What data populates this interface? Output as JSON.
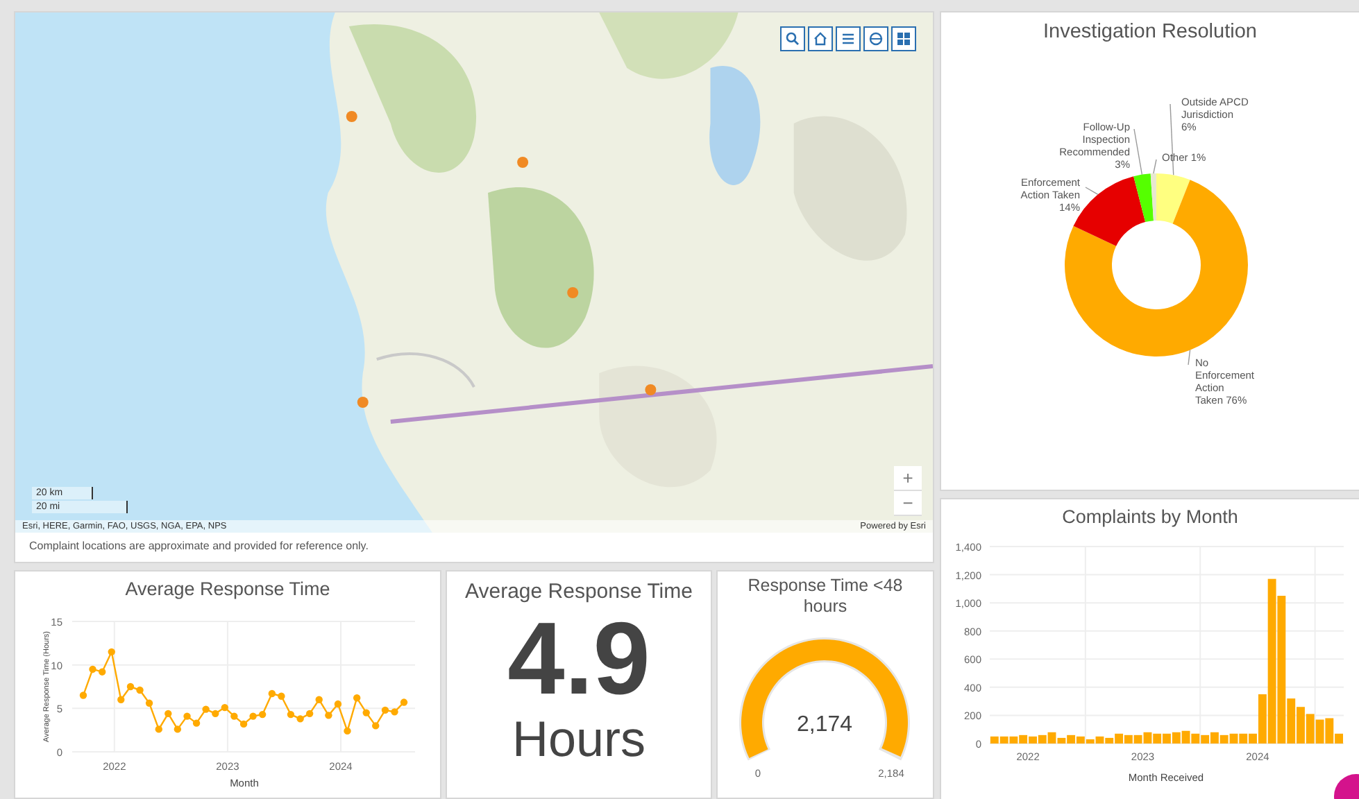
{
  "map": {
    "attribution": "Esri, HERE, Garmin, FAO, USGS, NGA, EPA, NPS",
    "powered_by": "Powered by Esri",
    "footer": "Complaint locations are approximate and provided for reference only.",
    "scale": [
      "20 km",
      "20 mi"
    ],
    "zoom_in": "+",
    "zoom_out": "−",
    "picture": {
      "kind": "picture"
    }
  },
  "investigation": {
    "title": "Investigation Resolution",
    "chart_data": {
      "type": "donut",
      "categories": [
        "Outside APCD Jurisdiction",
        "No Enforcement Action Taken",
        "Enforcement Action Taken",
        "Follow-Up Inspection Recommended",
        "Other"
      ],
      "values": [
        6,
        76,
        14,
        3,
        1
      ],
      "colors": [
        "#ffff80",
        "#ffaa00",
        "#e60000",
        "#55ff00",
        "#e8e8d0"
      ],
      "value_labels": [
        "6%",
        "76%",
        "14%",
        "3%",
        "1%"
      ]
    }
  },
  "complaints": {
    "title": "Complaints by Month",
    "chart_data": {
      "type": "bar",
      "xlabel": "Month Received",
      "x": [
        2021.708,
        2021.792,
        2021.875,
        2021.958,
        2022.042,
        2022.125,
        2022.208,
        2022.292,
        2022.375,
        2022.458,
        2022.542,
        2022.625,
        2022.708,
        2022.792,
        2022.875,
        2022.958,
        2023.042,
        2023.125,
        2023.208,
        2023.292,
        2023.375,
        2023.458,
        2023.542,
        2023.625,
        2023.708,
        2023.792,
        2023.875,
        2023.958,
        2024.042,
        2024.125,
        2024.208,
        2024.292,
        2024.375,
        2024.458,
        2024.542,
        2024.625,
        2024.708
      ],
      "xlim": [
        2021.667,
        2024.75
      ],
      "ylim": [
        0,
        1400
      ],
      "grid": true,
      "series": [
        {
          "color": "#ffaa00",
          "values": [
            50,
            50,
            50,
            60,
            50,
            60,
            80,
            40,
            60,
            50,
            30,
            50,
            40,
            70,
            60,
            60,
            80,
            70,
            70,
            80,
            90,
            70,
            60,
            80,
            60,
            70,
            70,
            70,
            350,
            1170,
            1050,
            320,
            260,
            210,
            170,
            180,
            70
          ]
        }
      ],
      "xticks": [
        {
          "value": 2022,
          "label": "2022"
        },
        {
          "value": 2023,
          "label": "2023"
        },
        {
          "value": 2024,
          "label": "2024"
        }
      ],
      "yticks": [
        {
          "value": 0,
          "label": "0"
        },
        {
          "value": 200,
          "label": "200"
        },
        {
          "value": 400,
          "label": "400"
        },
        {
          "value": 600,
          "label": "600"
        },
        {
          "value": 800,
          "label": "800"
        },
        {
          "value": 1000,
          "label": "1,000"
        },
        {
          "value": 1200,
          "label": "1,200"
        },
        {
          "value": 1400,
          "label": "1,400"
        }
      ]
    }
  },
  "response_chart": {
    "title": "Average Response Time",
    "chart_data": {
      "type": "line",
      "xlabel": "Month",
      "ylabel": "Average Response Time (Hours)",
      "x": [
        2021.725,
        2021.808,
        2021.892,
        2021.975,
        2022.058,
        2022.142,
        2022.225,
        2022.308,
        2022.392,
        2022.475,
        2022.558,
        2022.642,
        2022.725,
        2022.808,
        2022.892,
        2022.975,
        2023.058,
        2023.142,
        2023.225,
        2023.308,
        2023.392,
        2023.475,
        2023.558,
        2023.642,
        2023.725,
        2023.808,
        2023.892,
        2023.975,
        2024.058,
        2024.142,
        2024.225,
        2024.308,
        2024.392,
        2024.475,
        2024.558
      ],
      "xlim": [
        2021.627,
        2024.656
      ],
      "ylim": [
        0,
        15
      ],
      "grid": true,
      "series": [
        {
          "color": "#ffaa00",
          "marker": true,
          "values": [
            6.5,
            9.5,
            9.2,
            11.5,
            6,
            7.5,
            7.1,
            5.6,
            2.6,
            4.4,
            2.6,
            4.1,
            3.3,
            4.9,
            4.4,
            5.1,
            4.1,
            3.2,
            4.1,
            4.3,
            6.7,
            6.4,
            4.3,
            3.8,
            4.4,
            6,
            4.2,
            5.5,
            2.4,
            6.2,
            4.5,
            3,
            4.8,
            4.6,
            5.7
          ]
        }
      ],
      "xticks": [
        {
          "value": 2022,
          "label": "2022"
        },
        {
          "value": 2023,
          "label": "2023"
        },
        {
          "value": 2024,
          "label": "2024"
        }
      ],
      "yticks": [
        {
          "value": 0,
          "label": "0"
        },
        {
          "value": 5,
          "label": "5"
        },
        {
          "value": 10,
          "label": "10"
        },
        {
          "value": 15,
          "label": "15"
        }
      ]
    }
  },
  "average": {
    "title": "Average Response Time",
    "value": "4.9",
    "unit": "Hours"
  },
  "gauge": {
    "title": "Response Time <48 hours",
    "value": "2,174",
    "min": "0",
    "max": "2,184",
    "level": 0.995
  }
}
